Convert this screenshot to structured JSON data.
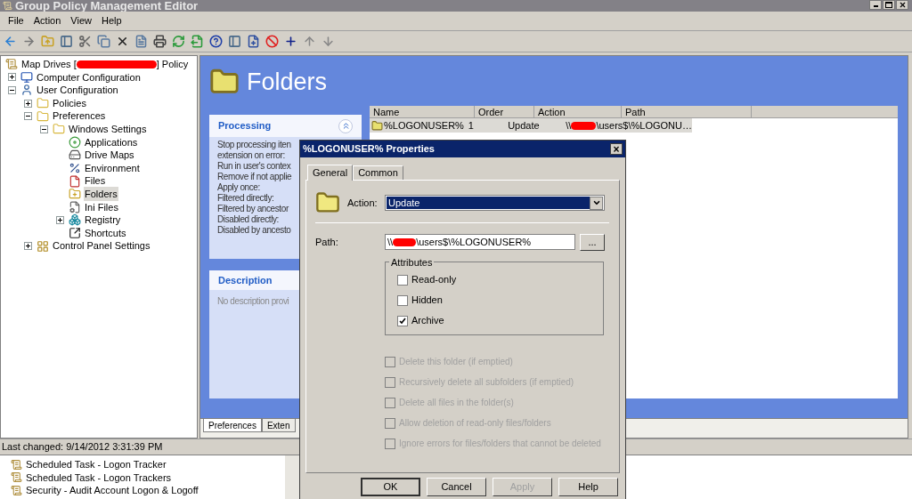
{
  "window": {
    "title": "Group Policy Management Editor"
  },
  "menu": [
    "File",
    "Action",
    "View",
    "Help"
  ],
  "tree": {
    "label_before": "Map Drives [",
    "label_after": "] Policy",
    "redacted": true,
    "children": [
      {
        "label": "Computer Configuration",
        "kind": "computer",
        "expanded": false,
        "selected": false
      },
      {
        "label": "User Configuration",
        "kind": "user",
        "expanded": true,
        "selected": false,
        "children": [
          {
            "label": "Policies",
            "kind": "folder",
            "expanded": false,
            "selected": false
          },
          {
            "label": "Preferences",
            "kind": "folder",
            "expanded": true,
            "selected": false,
            "children": [
              {
                "label": "Windows Settings",
                "kind": "folder",
                "expanded": true,
                "selected": false,
                "children": [
                  {
                    "label": "Applications",
                    "kind": "disc",
                    "selected": false
                  },
                  {
                    "label": "Drive Maps",
                    "kind": "drive",
                    "selected": false
                  },
                  {
                    "label": "Environment",
                    "kind": "percent",
                    "selected": false
                  },
                  {
                    "label": "Files",
                    "kind": "file",
                    "selected": false
                  },
                  {
                    "label": "Folders",
                    "kind": "new-folder",
                    "selected": true
                  },
                  {
                    "label": "Ini Files",
                    "kind": "ini",
                    "selected": false
                  },
                  {
                    "label": "Registry",
                    "kind": "registry",
                    "expanded": false,
                    "selected": false
                  },
                  {
                    "label": "Shortcuts",
                    "kind": "shortcut",
                    "selected": false
                  }
                ]
              }
            ]
          },
          {
            "label": "Control Panel Settings",
            "kind": "control-panel",
            "expanded": false,
            "selected": false
          }
        ]
      }
    ]
  },
  "header": {
    "title": "Folders"
  },
  "processing": {
    "title": "Processing",
    "lines": [
      "Stop processing iten",
      "extension on error:",
      "Run in user's contex",
      "Remove if not applie",
      "Apply once:",
      "Filtered directly:",
      "Filtered by ancestor",
      "Disabled directly:",
      "Disabled by ancesto"
    ]
  },
  "description": {
    "title": "Description",
    "text": "No description provi"
  },
  "table": {
    "columns": [
      "Name",
      "Order",
      "Action",
      "Path"
    ],
    "rows": [
      {
        "name": "%LOGONUSER%",
        "order": "1",
        "action": "Update",
        "path_before": "\\\\",
        "path_after": "\\users$\\%LOGONU…",
        "redacted": true,
        "selected": true
      }
    ]
  },
  "bottom_tabs": [
    {
      "label": "Preferences",
      "selected": true
    },
    {
      "label": "Exten",
      "selected": false
    }
  ],
  "status_bar": "Last changed: 9/14/2012 3:31:39 PM",
  "background_list": [
    "Scheduled Task - Logon Tracker",
    "Scheduled Task - Logon Trackers",
    "Security - Audit Account Logon & Logoff"
  ],
  "dialog": {
    "title": "%LOGONUSER% Properties",
    "close": "×",
    "tabs": [
      {
        "label": "General",
        "selected": true
      },
      {
        "label": "Common",
        "selected": false
      }
    ],
    "action_label": "Action:",
    "action_value": "Update",
    "path_label": "Path:",
    "path_before": "\\\\",
    "path_after": "\\users$\\%LOGONUSER%",
    "path_redacted": true,
    "browse": "...",
    "attributes_title": "Attributes",
    "attributes": [
      {
        "label": "Read-only",
        "checked": false
      },
      {
        "label": "Hidden",
        "checked": false
      },
      {
        "label": "Archive",
        "checked": true
      }
    ],
    "options": [
      {
        "label": "Delete this folder (if emptied)",
        "checked": false,
        "disabled": true
      },
      {
        "label": "Recursively delete all subfolders (if emptied)",
        "checked": false,
        "disabled": true
      },
      {
        "label": "Delete all files in the folder(s)",
        "checked": false,
        "disabled": true
      },
      {
        "label": "Allow deletion of read-only files/folders",
        "checked": false,
        "disabled": true
      },
      {
        "label": "Ignore errors for files/folders that cannot be deleted",
        "checked": false,
        "disabled": true
      }
    ],
    "buttons": [
      {
        "label": "OK",
        "disabled": false,
        "default": true
      },
      {
        "label": "Cancel",
        "disabled": false,
        "default": false
      },
      {
        "label": "Apply",
        "disabled": true,
        "default": false
      },
      {
        "label": "Help",
        "disabled": false,
        "default": false
      }
    ]
  }
}
